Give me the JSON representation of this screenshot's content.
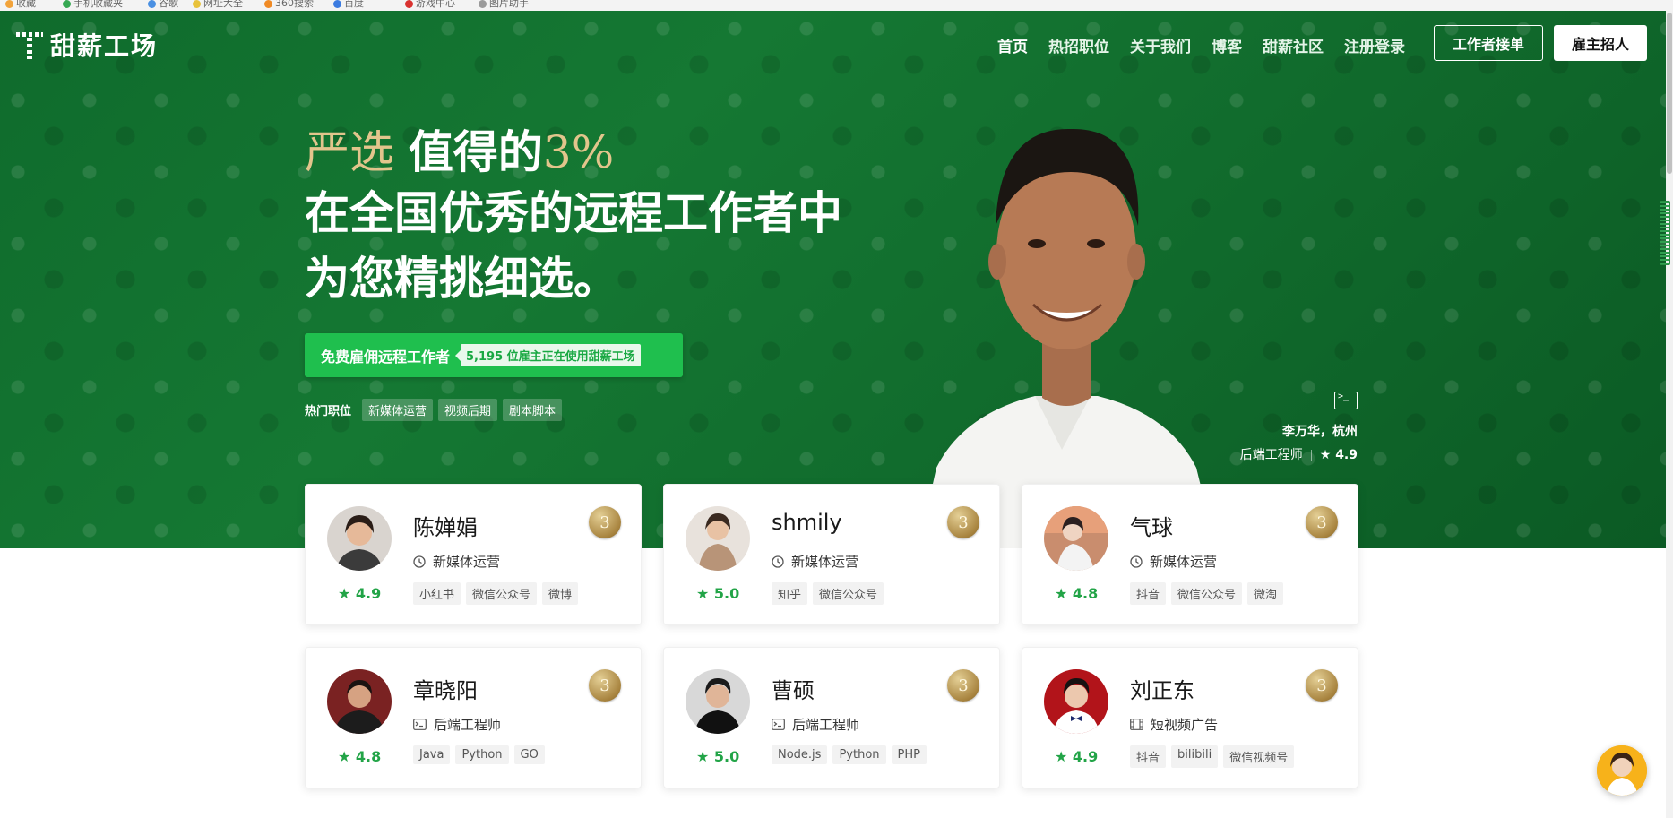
{
  "bookmarks": [
    "收藏",
    "手机收藏夹",
    "谷歌",
    "网址大全",
    "360搜索",
    "百度",
    "游戏中心",
    "图片助手"
  ],
  "nav": {
    "logo_text": "甜薪工场",
    "links": [
      "首页",
      "热招职位",
      "关于我们",
      "博客",
      "甜薪社区",
      "注册登录"
    ],
    "worker_button": "工作者接单",
    "employer_button": "雇主招人"
  },
  "hero": {
    "line1_gold_a": "严选",
    "line1_white": "值得的",
    "line1_gold_b": "3%",
    "line2": "在全国优秀的远程工作者中",
    "line3": "为您精挑细选。",
    "cta_label": "免费雇佣远程工作者",
    "cta_badge": "5,195 位雇主正在使用甜薪工场",
    "hot_label": "热门职位",
    "hot_tags": [
      "新媒体运营",
      "视频后期",
      "剧本脚本"
    ],
    "featured": {
      "name": "李万华，杭州",
      "role": "后端工程师",
      "rating": "★ 4.9"
    }
  },
  "cards": [
    {
      "name": "陈婵娟",
      "role": "新媒体运营",
      "role_icon": "clock-icon",
      "rating": "★ 4.9",
      "tags": [
        "小红书",
        "微信公众号",
        "微博"
      ],
      "badge": "3",
      "avatar_color": "#8a6a58"
    },
    {
      "name": "shmily",
      "role": "新媒体运营",
      "role_icon": "clock-icon",
      "rating": "★ 5.0",
      "tags": [
        "知乎",
        "微信公众号"
      ],
      "badge": "3",
      "avatar_color": "#b89478"
    },
    {
      "name": "气球",
      "role": "新媒体运营",
      "role_icon": "clock-icon",
      "rating": "★ 4.8",
      "tags": [
        "抖音",
        "微信公众号",
        "微淘"
      ],
      "badge": "3",
      "avatar_color": "#c48a6a"
    },
    {
      "name": "章晓阳",
      "role": "后端工程师",
      "role_icon": "terminal-icon",
      "rating": "★ 4.8",
      "tags": [
        "Java",
        "Python",
        "GO"
      ],
      "badge": "3",
      "avatar_color": "#5a2b2b"
    },
    {
      "name": "曹硕",
      "role": "后端工程师",
      "role_icon": "terminal-icon",
      "rating": "★ 5.0",
      "tags": [
        "Node.js",
        "Python",
        "PHP"
      ],
      "badge": "3",
      "avatar_color": "#6a6a6a"
    },
    {
      "name": "刘正东",
      "role": "短视频广告",
      "role_icon": "film-icon",
      "rating": "★ 4.9",
      "tags": [
        "抖音",
        "bilibili",
        "微信视频号"
      ],
      "badge": "3",
      "avatar_color": "#b2141a"
    }
  ]
}
